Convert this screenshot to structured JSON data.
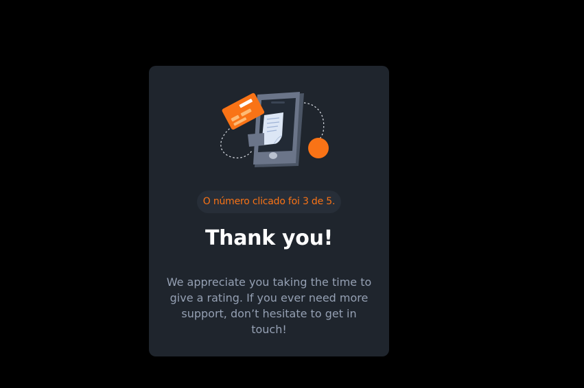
{
  "card": {
    "illustration_icon": "phone-payment-receipt-illustration",
    "selected_rating_text": "O número clicado foi 3 de 5.",
    "title": "Thank you!",
    "message": "We appreciate you taking the time to give a rating. If you ever need more support, don’t hesitate to get in touch!"
  },
  "colors": {
    "page_background": "#000000",
    "card_background": "#1f252d",
    "accent": "#f97316",
    "badge_background": "#272e38",
    "title_text": "#ffffff",
    "body_text": "#95a0b3"
  }
}
